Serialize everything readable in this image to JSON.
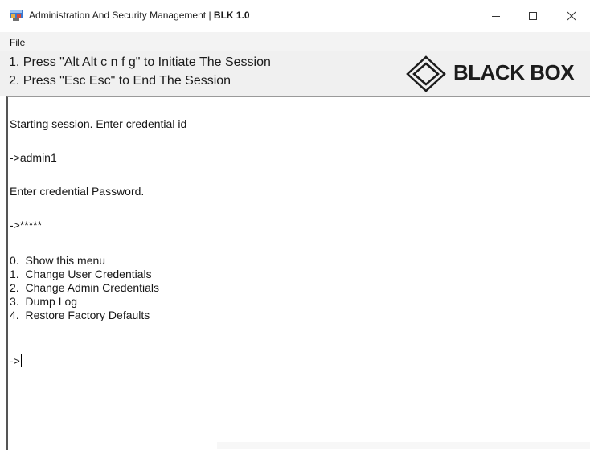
{
  "window": {
    "title": "Administration And Security Management  |",
    "build": "BLK 1.0",
    "minimize_glyph": "–",
    "maximize_glyph": "☐",
    "close_glyph": "✕"
  },
  "menu": {
    "file_label": "File"
  },
  "header": {
    "instruction_1": "1. Press \"Alt Alt c n f g\" to Initiate The Session",
    "instruction_2": "2. Press \"Esc Esc\" to End The Session",
    "logo_text": "BLACK BOX"
  },
  "console": {
    "lines": [
      "Starting session. Enter credential id",
      "->admin1",
      "Enter credential Password.",
      "->*****",
      "0.  Show this menu",
      "1.  Change User Credentials",
      "2.  Change Admin Credentials",
      "3.  Dump Log",
      "4.  Restore Factory Defaults"
    ],
    "prompt": "->"
  },
  "icons": {
    "app": "app-window-icon",
    "logo": "black-box-diamond-logo-icon"
  }
}
